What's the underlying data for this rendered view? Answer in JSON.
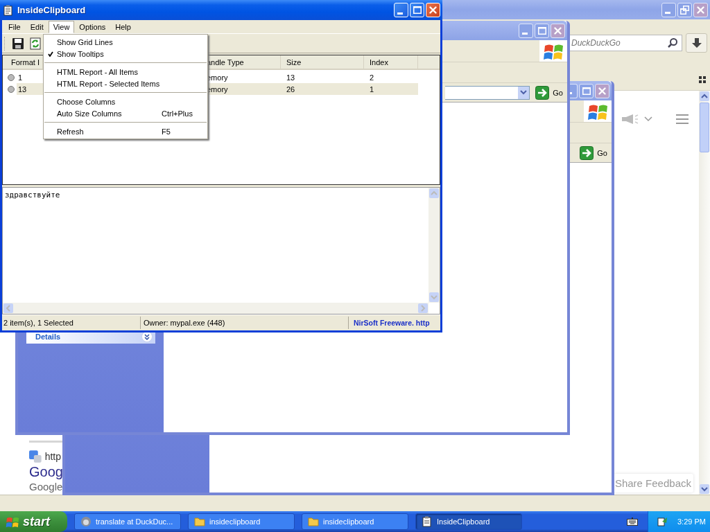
{
  "browser_window": {
    "search_placeholder": "DuckDuckGo",
    "result_url": "http",
    "result_title": "Goog",
    "result_snippet": "Google",
    "feedback_button": "Share Feedback"
  },
  "explorer_windows": [
    {
      "go_button": "Go",
      "sidebar_section": "Details"
    },
    {
      "go_button": "Go"
    }
  ],
  "app_window": {
    "title": "InsideClipboard",
    "menu_bar": [
      {
        "label": "File",
        "selected": false
      },
      {
        "label": "Edit",
        "selected": false
      },
      {
        "label": "View",
        "selected": true
      },
      {
        "label": "Options",
        "selected": false
      },
      {
        "label": "Help",
        "selected": false
      }
    ],
    "view_menu": [
      {
        "kind": "item",
        "label": "Show Grid Lines",
        "checked": false
      },
      {
        "kind": "item",
        "label": "Show Tooltips",
        "checked": true
      },
      {
        "kind": "separator"
      },
      {
        "kind": "item",
        "label": "HTML Report - All Items",
        "checked": false
      },
      {
        "kind": "item",
        "label": "HTML Report - Selected Items",
        "checked": false
      },
      {
        "kind": "separator"
      },
      {
        "kind": "item",
        "label": "Choose Columns",
        "checked": false
      },
      {
        "kind": "item",
        "label": "Auto Size Columns",
        "checked": false,
        "shortcut": "Ctrl+Plus"
      },
      {
        "kind": "separator"
      },
      {
        "kind": "item",
        "label": "Refresh",
        "checked": false,
        "shortcut": "F5"
      }
    ],
    "table": {
      "columns": [
        "Format I",
        "andle Type",
        "Size",
        "Index"
      ],
      "rows": [
        {
          "selected": false,
          "cells": [
            "1",
            "emory",
            "13",
            "2"
          ]
        },
        {
          "selected": true,
          "cells": [
            "13",
            "emory",
            "26",
            "1"
          ]
        }
      ]
    },
    "content": "здравствуйте",
    "status_bar": [
      "2 item(s), 1 Selected",
      "Owner: mypal.exe (448)",
      "NirSoft Freeware. http"
    ]
  },
  "taskbar": {
    "start": "start",
    "tasks": [
      {
        "kind": "browser",
        "label": "translate at DuckDuc...",
        "selected": false
      },
      {
        "kind": "folder",
        "label": "insideclipboard",
        "selected": false
      },
      {
        "kind": "folder",
        "label": "insideclipboard",
        "selected": false
      },
      {
        "kind": "clipboard",
        "label": "InsideClipboard",
        "selected": true
      }
    ],
    "clock": "3:29 PM"
  }
}
